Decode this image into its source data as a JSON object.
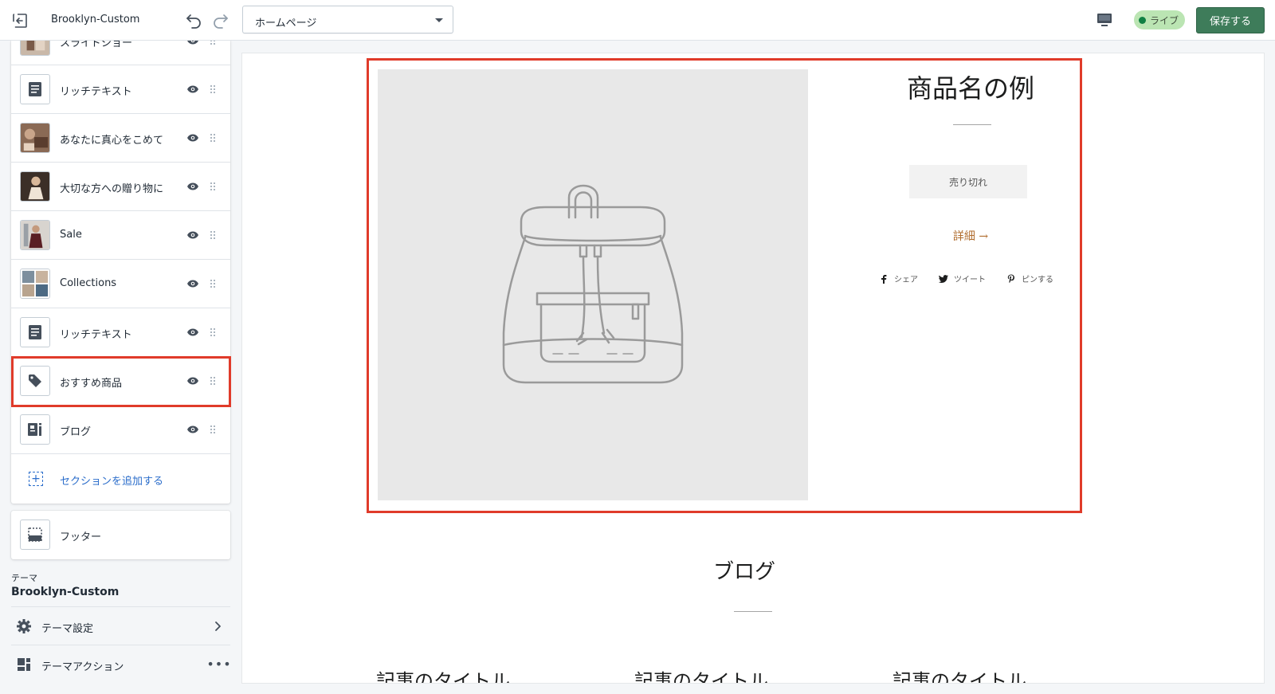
{
  "topbar": {
    "theme_title": "Brooklyn-Custom",
    "page_select_value": "ホームページ",
    "live_label": "ライブ",
    "save_label": "保存する"
  },
  "sidebar": {
    "sections": [
      {
        "label": "スライドショー",
        "icon": "image-thumbnail"
      },
      {
        "label": "リッチテキスト",
        "icon": "text-block-icon"
      },
      {
        "label": "あなたに真心をこめて",
        "icon": "image-thumbnail"
      },
      {
        "label": "大切な方への贈り物に",
        "icon": "image-thumbnail"
      },
      {
        "label": "Sale",
        "icon": "image-thumbnail"
      },
      {
        "label": "Collections",
        "icon": "image-thumbnail"
      },
      {
        "label": "リッチテキスト",
        "icon": "text-block-icon"
      },
      {
        "label": "おすすめ商品",
        "icon": "tag-icon"
      },
      {
        "label": "ブログ",
        "icon": "blog-icon"
      }
    ],
    "add_section_label": "セクションを追加する",
    "footer_label": "フッター",
    "theme_label": "テーマ",
    "theme_name": "Brooklyn-Custom",
    "theme_settings_label": "テーマ設定",
    "theme_actions_label": "テーマアクション"
  },
  "preview": {
    "product_title": "商品名の例",
    "soldout_label": "売り切れ",
    "detail_link": "詳細 →",
    "share": [
      "シェア",
      "ツイート",
      "ピンする"
    ],
    "blog_heading": "ブログ",
    "article_titles": [
      "記事のタイトル",
      "記事のタイトル",
      "記事のタイトル"
    ]
  },
  "colors": {
    "accent_green": "#3e7c5a",
    "live_badge_bg": "#bbe5b3",
    "highlight_red": "#e03b2a",
    "link_blue": "#2c6ecb",
    "detail_link_brown": "#b06d2e"
  }
}
